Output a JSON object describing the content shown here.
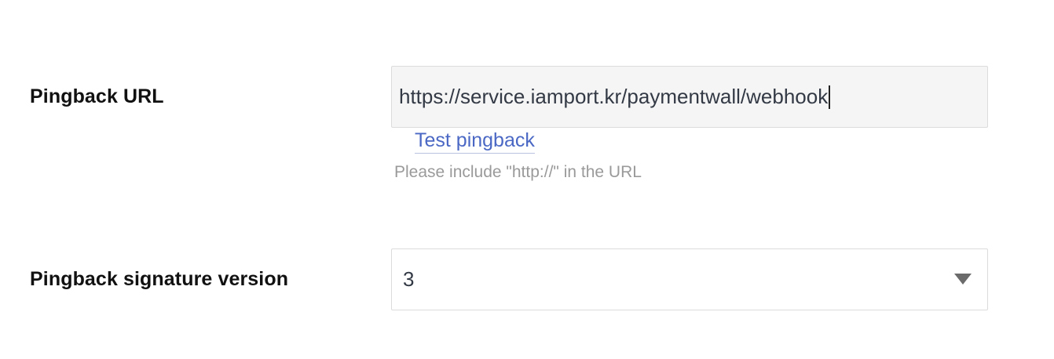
{
  "pingback_url": {
    "label": "Pingback URL",
    "value": "https://service.iamport.kr/paymentwall/webhook",
    "test_link": "Test pingback",
    "hint": "Please include \"http://\" in the URL"
  },
  "signature_version": {
    "label": "Pingback signature version",
    "selected": "3",
    "icon": "chevron-down-icon"
  },
  "colors": {
    "link": "#4a68c4",
    "input_bg": "#f5f5f5",
    "border": "#dcdcdc",
    "hint": "#9a9a9a"
  }
}
